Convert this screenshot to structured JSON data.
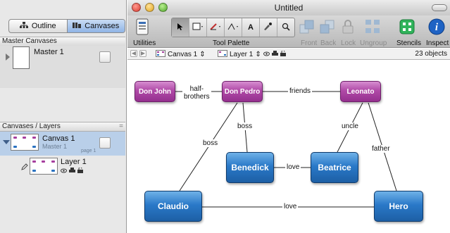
{
  "window": {
    "title": "Untitled"
  },
  "sidebar": {
    "segments": [
      {
        "label": "Outline",
        "icon": "outline-tree-icon",
        "active": false
      },
      {
        "label": "Canvases",
        "icon": "canvases-icon",
        "active": true
      }
    ],
    "master_header": "Master Canvases",
    "master_item": "Master 1",
    "layers_header": "Canvases / Layers",
    "canvas_item": {
      "name": "Canvas 1",
      "master": "Master 1",
      "page": "page 1"
    },
    "layer_item": {
      "name": "Layer 1"
    }
  },
  "toolbar": {
    "utilities": "Utilities",
    "tool_palette": "Tool Palette",
    "front": "Front",
    "back": "Back",
    "lock": "Lock",
    "ungroup": "Ungroup",
    "stencils": "Stencils",
    "inspect": "Inspect",
    "text_tool": "A"
  },
  "navbar": {
    "canvas": "Canvas 1",
    "layer": "Layer 1",
    "object_count": "23 objects"
  },
  "diagram": {
    "nodes": [
      {
        "id": "don_john",
        "label": "Don John",
        "color": "#a63e9e"
      },
      {
        "id": "don_pedro",
        "label": "Don Pedro",
        "color": "#a63e9e"
      },
      {
        "id": "leonato",
        "label": "Leonato",
        "color": "#a63e9e"
      },
      {
        "id": "benedick",
        "label": "Benedick",
        "color": "#2a72c0"
      },
      {
        "id": "beatrice",
        "label": "Beatrice",
        "color": "#2a72c0"
      },
      {
        "id": "claudio",
        "label": "Claudio",
        "color": "#2a72c0"
      },
      {
        "id": "hero",
        "label": "Hero",
        "color": "#2a72c0"
      }
    ],
    "edges": [
      {
        "from": "Don John",
        "to": "Don Pedro",
        "label": "half-brothers"
      },
      {
        "from": "Don Pedro",
        "to": "Leonato",
        "label": "friends"
      },
      {
        "from": "Don Pedro",
        "to": "Benedick",
        "label": "boss"
      },
      {
        "from": "Don Pedro",
        "to": "Claudio",
        "label": "boss"
      },
      {
        "from": "Leonato",
        "to": "Beatrice",
        "label": "uncle"
      },
      {
        "from": "Leonato",
        "to": "Hero",
        "label": "father"
      },
      {
        "from": "Benedick",
        "to": "Beatrice",
        "label": "love"
      },
      {
        "from": "Claudio",
        "to": "Hero",
        "label": "love"
      }
    ],
    "edge_label_lines": {
      "half_brothers_1": "half-",
      "half_brothers_2": "brothers"
    }
  }
}
